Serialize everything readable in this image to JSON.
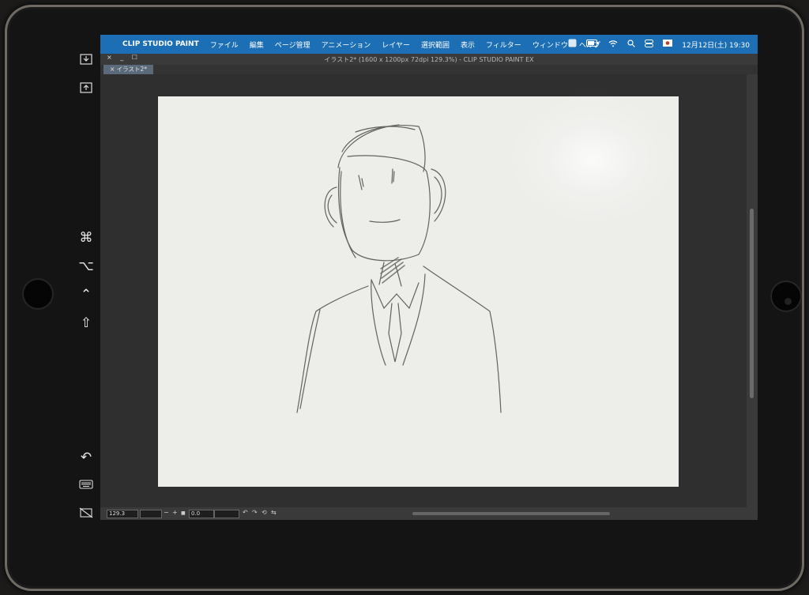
{
  "menubar": {
    "apple_glyph": "",
    "app_name": "CLIP STUDIO PAINT",
    "items": [
      "ファイル",
      "編集",
      "ページ管理",
      "アニメーション",
      "レイヤー",
      "選択範囲",
      "表示",
      "フィルター",
      "ウィンドウ",
      "ヘルプ"
    ],
    "clock": "12月12日(土)  19:30",
    "accent_color": "#1c6fb5"
  },
  "window": {
    "controls": "× _ ☐",
    "title": "イラスト2* (1600 x 1200px 72dpi 129.3%)  - CLIP STUDIO PAINT EX",
    "tab": "× イラスト2*"
  },
  "sidecar": {
    "icons": [
      "download-tray-icon",
      "upload-tray-icon",
      "command-key-icon",
      "option-key-icon",
      "control-key-icon",
      "shift-key-icon",
      "undo-icon",
      "keyboard-icon",
      "hide-screen-icon"
    ],
    "glyphs": {
      "command": "⌘",
      "option": "⌥",
      "control": "⌃",
      "shift": "⇧",
      "undo": "↶"
    }
  },
  "statusbar": {
    "zoom": "129.3",
    "rotation": "0.0",
    "zoom_out": "−",
    "zoom_in": "+",
    "fit": "■"
  }
}
